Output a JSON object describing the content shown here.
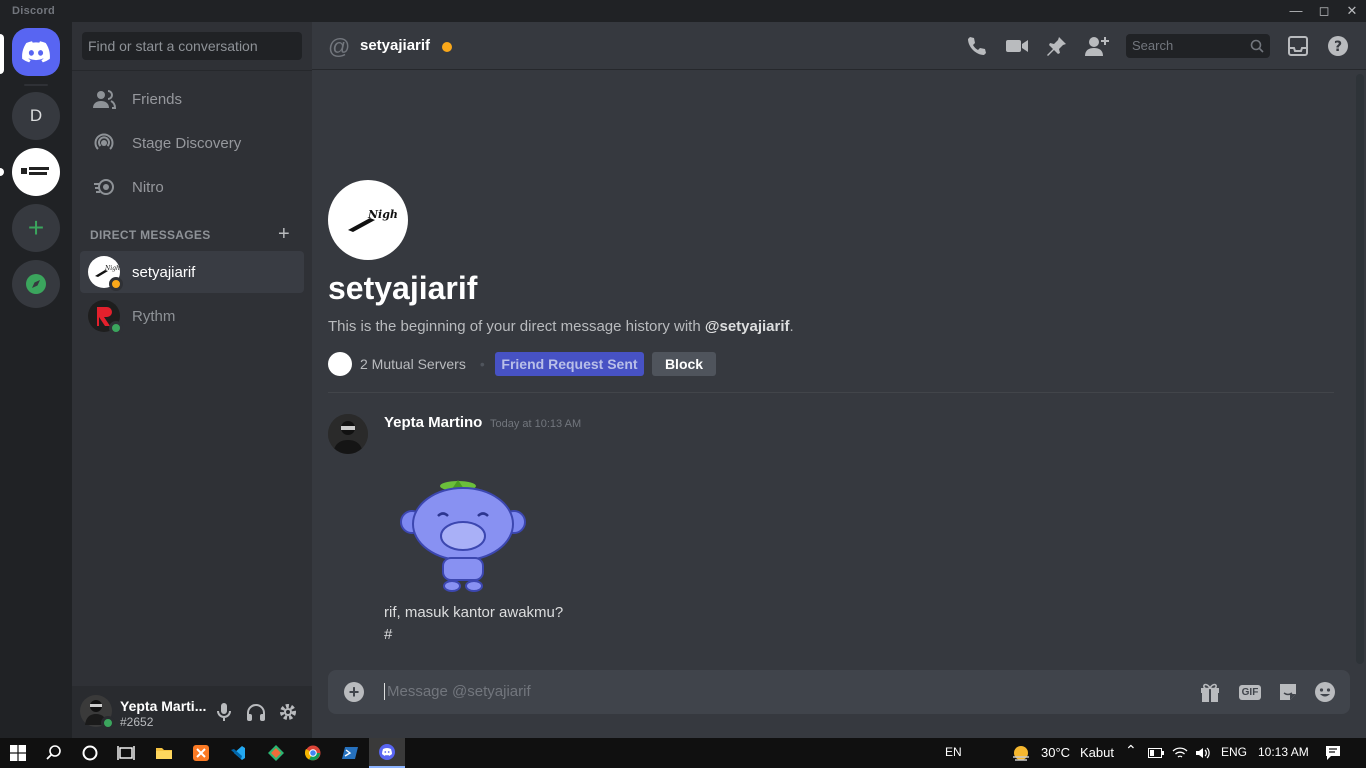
{
  "window": {
    "app_name": "Discord"
  },
  "guilds": {
    "dm_letter": "D"
  },
  "sidebar": {
    "search_placeholder": "Find or start a conversation",
    "nav": [
      {
        "label": "Friends"
      },
      {
        "label": "Stage Discovery"
      },
      {
        "label": "Nitro"
      }
    ],
    "dm_header": "DIRECT MESSAGES",
    "dms": [
      {
        "label": "setyajiarif",
        "status": "idle"
      },
      {
        "label": "Rythm",
        "status": "online"
      }
    ]
  },
  "user_panel": {
    "name": "Yepta Marti...",
    "tag": "#2652"
  },
  "topbar": {
    "title": "setyajiarif",
    "search_placeholder": "Search"
  },
  "intro": {
    "name": "setyajiarif",
    "desc_prefix": "This is the beginning of your direct message history with ",
    "desc_handle": "@setyajiarif",
    "desc_suffix": ".",
    "mutual_servers": "2 Mutual Servers",
    "friend_button": "Friend Request Sent",
    "block_button": "Block"
  },
  "message": {
    "author": "Yepta Martino",
    "timestamp": "Today at 10:13 AM",
    "lines": [
      "rif, masuk kantor awakmu?",
      "#"
    ]
  },
  "composer": {
    "placeholder": "Message @setyajiarif",
    "gif_label": "GIF"
  },
  "taskbar": {
    "lang_short": "EN",
    "weather_temp": "30°C",
    "weather_desc": "Kabut",
    "lang": "ENG",
    "time": "10:13 AM"
  },
  "colors": {
    "blurple": "#5865f2",
    "online": "#3ba55d",
    "idle": "#faa81a"
  }
}
